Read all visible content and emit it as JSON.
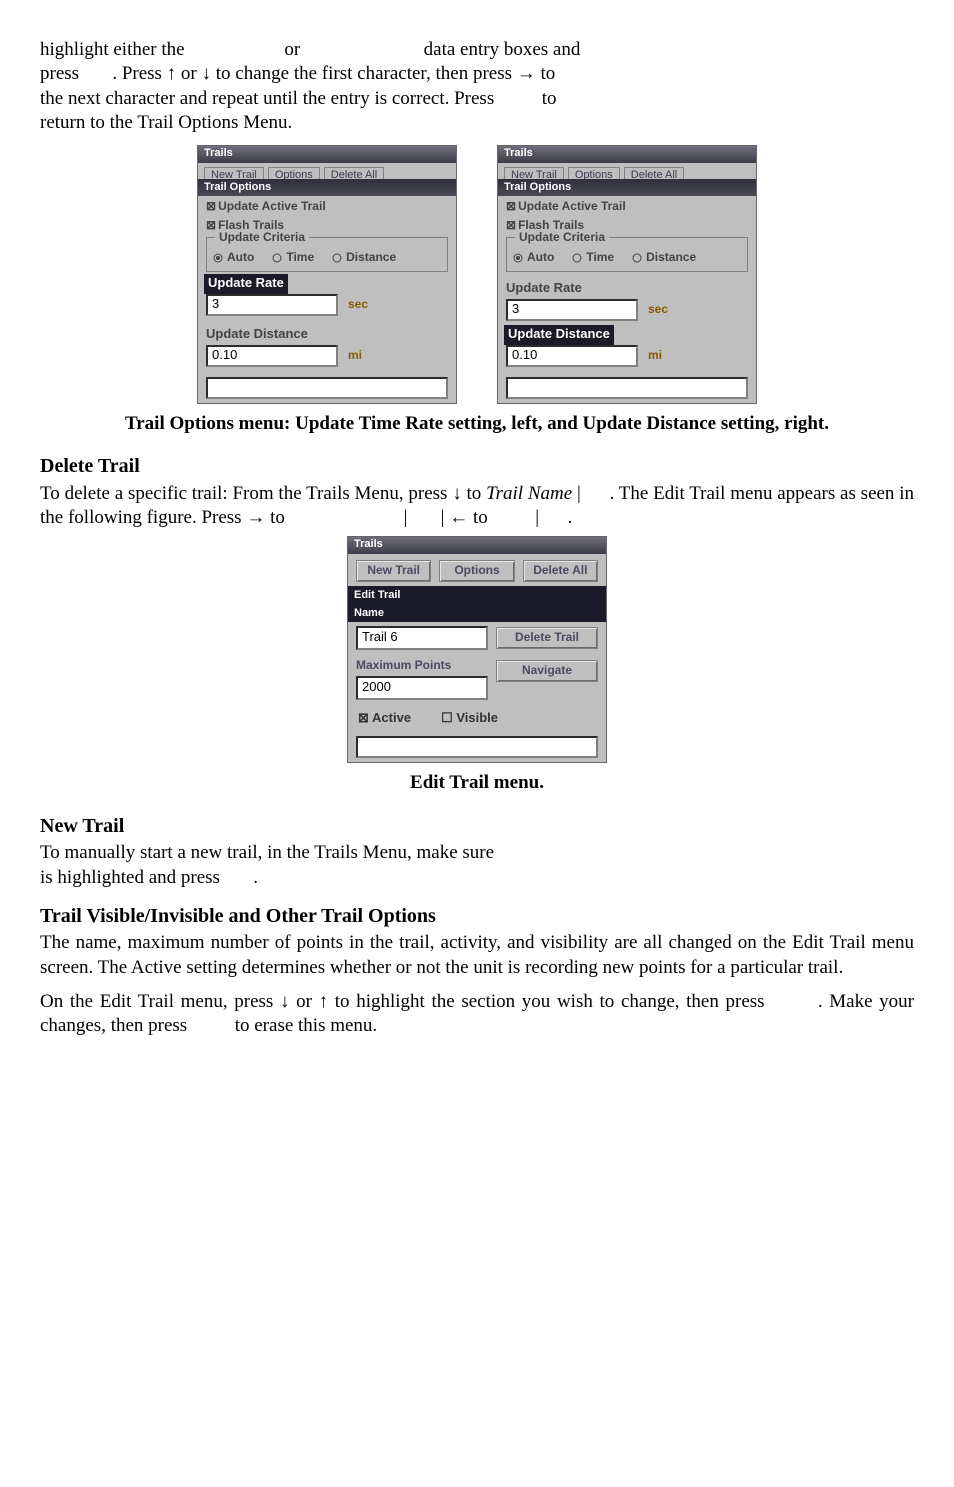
{
  "intro": {
    "line1a": "highlight either the ",
    "line1b": "or",
    "line1c": " data entry boxes and",
    "line2a": "press ",
    "line2b": ". Press ↑ or ↓  to change the first character, then press → to",
    "line3": "the next character and repeat until the entry is correct. Press",
    "line3b": "to",
    "line4": "return to the Trail Options Menu."
  },
  "panel_left": {
    "title": "Trails",
    "tabs": [
      "New Trail",
      "Options",
      "Delete All"
    ],
    "subtitle": "Trail Options",
    "chk1": "Update Active Trail",
    "chk2": "Flash Trails",
    "group_label": "Update Criteria",
    "radios": [
      "Auto",
      "Time",
      "Distance"
    ],
    "radio_selected": 0,
    "rate_label": "Update Rate",
    "rate_value": "3",
    "rate_unit": "sec",
    "dist_label": "Update Distance",
    "dist_value": "0.10",
    "dist_unit": "mi",
    "highlight": "rate"
  },
  "panel_right": {
    "title": "Trails",
    "tabs": [
      "New Trail",
      "Options",
      "Delete All"
    ],
    "subtitle": "Trail Options",
    "chk1": "Update Active Trail",
    "chk2": "Flash Trails",
    "group_label": "Update Criteria",
    "radios": [
      "Auto",
      "Time",
      "Distance"
    ],
    "radio_selected": 0,
    "rate_label": "Update Rate",
    "rate_value": "3",
    "rate_unit": "sec",
    "dist_label": "Update Distance",
    "dist_value": "0.10",
    "dist_unit": "mi",
    "highlight": "distance"
  },
  "caption1": "Trail Options menu: Update Time Rate setting, left, and Update Distance setting, right.",
  "delete_trail": {
    "heading": "Delete Trail",
    "p1a": "To delete a specific trail: From the Trails Menu, press ↓  to ",
    "p1b": "Trail Name",
    "p1c": "|",
    "p1d": ". The Edit Trail menu appears as seen in the following figure. Press → to",
    "p1e": "|",
    "p1f": "| ← to",
    "p1g": "|",
    "p1h": "."
  },
  "edit_panel": {
    "title": "Trails",
    "buttons": [
      "New Trail",
      "Options",
      "Delete All"
    ],
    "subtitle": "Edit Trail",
    "name_label": "Name",
    "name_value": "Trail 6",
    "delete_btn": "Delete Trail",
    "maxpts_label": "Maximum Points",
    "maxpts_value": "2000",
    "navigate_btn": "Navigate",
    "active_label": "Active",
    "visible_label": "Visible",
    "active_checked": true,
    "visible_checked": false
  },
  "caption2": "Edit Trail menu.",
  "new_trail": {
    "heading": "New Trail",
    "p1": "To manually start a new trail, in the Trails Menu, make sure",
    "p2": "is highlighted and press",
    "p2b": "."
  },
  "visibility": {
    "heading": "Trail Visible/Invisible and Other Trail Options",
    "p": "The name, maximum number of points in the trail, activity, and visibility are all changed on the Edit Trail menu screen. The Active setting determines whether or not the unit is recording new points for a particular trail.",
    "p2a": "On the Edit Trail menu, press ↓ or ↑ to highlight the section you wish to change, then press",
    "p2b": ". Make your changes, then press",
    "p2c": "to erase this menu."
  }
}
